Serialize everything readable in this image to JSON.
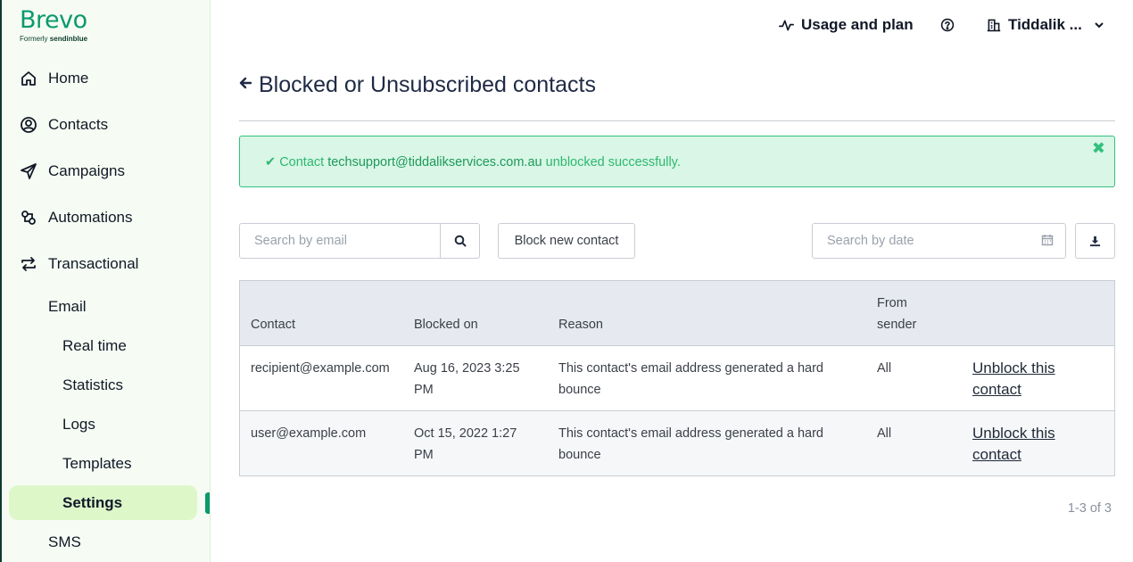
{
  "brand": {
    "name": "Brevo",
    "formerly": "Formerly",
    "formerly_brand": "sendinblue",
    "color": "#0b996e"
  },
  "sidebar": {
    "items": [
      {
        "label": "Home",
        "icon": "home-icon"
      },
      {
        "label": "Contacts",
        "icon": "contacts-icon"
      },
      {
        "label": "Campaigns",
        "icon": "send-icon"
      },
      {
        "label": "Automations",
        "icon": "automation-icon"
      },
      {
        "label": "Transactional",
        "icon": "transfer-icon"
      }
    ],
    "email_label": "Email",
    "sub_items": [
      "Real time",
      "Statistics",
      "Logs",
      "Templates",
      "Settings"
    ],
    "sms_label": "SMS"
  },
  "topbar": {
    "usage": "Usage and plan",
    "help_icon": "help-circle-icon",
    "account": "Tiddalik ..."
  },
  "page": {
    "title": "Blocked or Unsubscribed contacts"
  },
  "alert": {
    "prefix": "Contact",
    "email": "techsupport@tiddalikservices.com.au",
    "suffix": "unblocked successfully.",
    "color": "#35c07f"
  },
  "toolbar": {
    "search_placeholder": "Search by email",
    "block_label": "Block new contact",
    "date_placeholder": "Search by date"
  },
  "table": {
    "headers": {
      "contact": "Contact",
      "blocked_on": "Blocked on",
      "reason": "Reason",
      "from_sender_1": "From",
      "from_sender_2": "sender"
    },
    "rows": [
      {
        "contact": "recipient@example.com",
        "blocked_on_1": "Aug 16, 2023 3:25",
        "blocked_on_2": "PM",
        "reason_1": "This contact's email address generated a hard",
        "reason_2": "bounce",
        "from": "All",
        "action_1": "Unblock this",
        "action_2": "contact"
      },
      {
        "contact": "user@example.com",
        "blocked_on_1": "Oct 15, 2022 1:27",
        "blocked_on_2": "PM",
        "reason_1": "This contact's email address generated a hard",
        "reason_2": "bounce",
        "from": "All",
        "action_1": "Unblock this",
        "action_2": "contact"
      }
    ]
  },
  "pagination": "1-3 of 3"
}
